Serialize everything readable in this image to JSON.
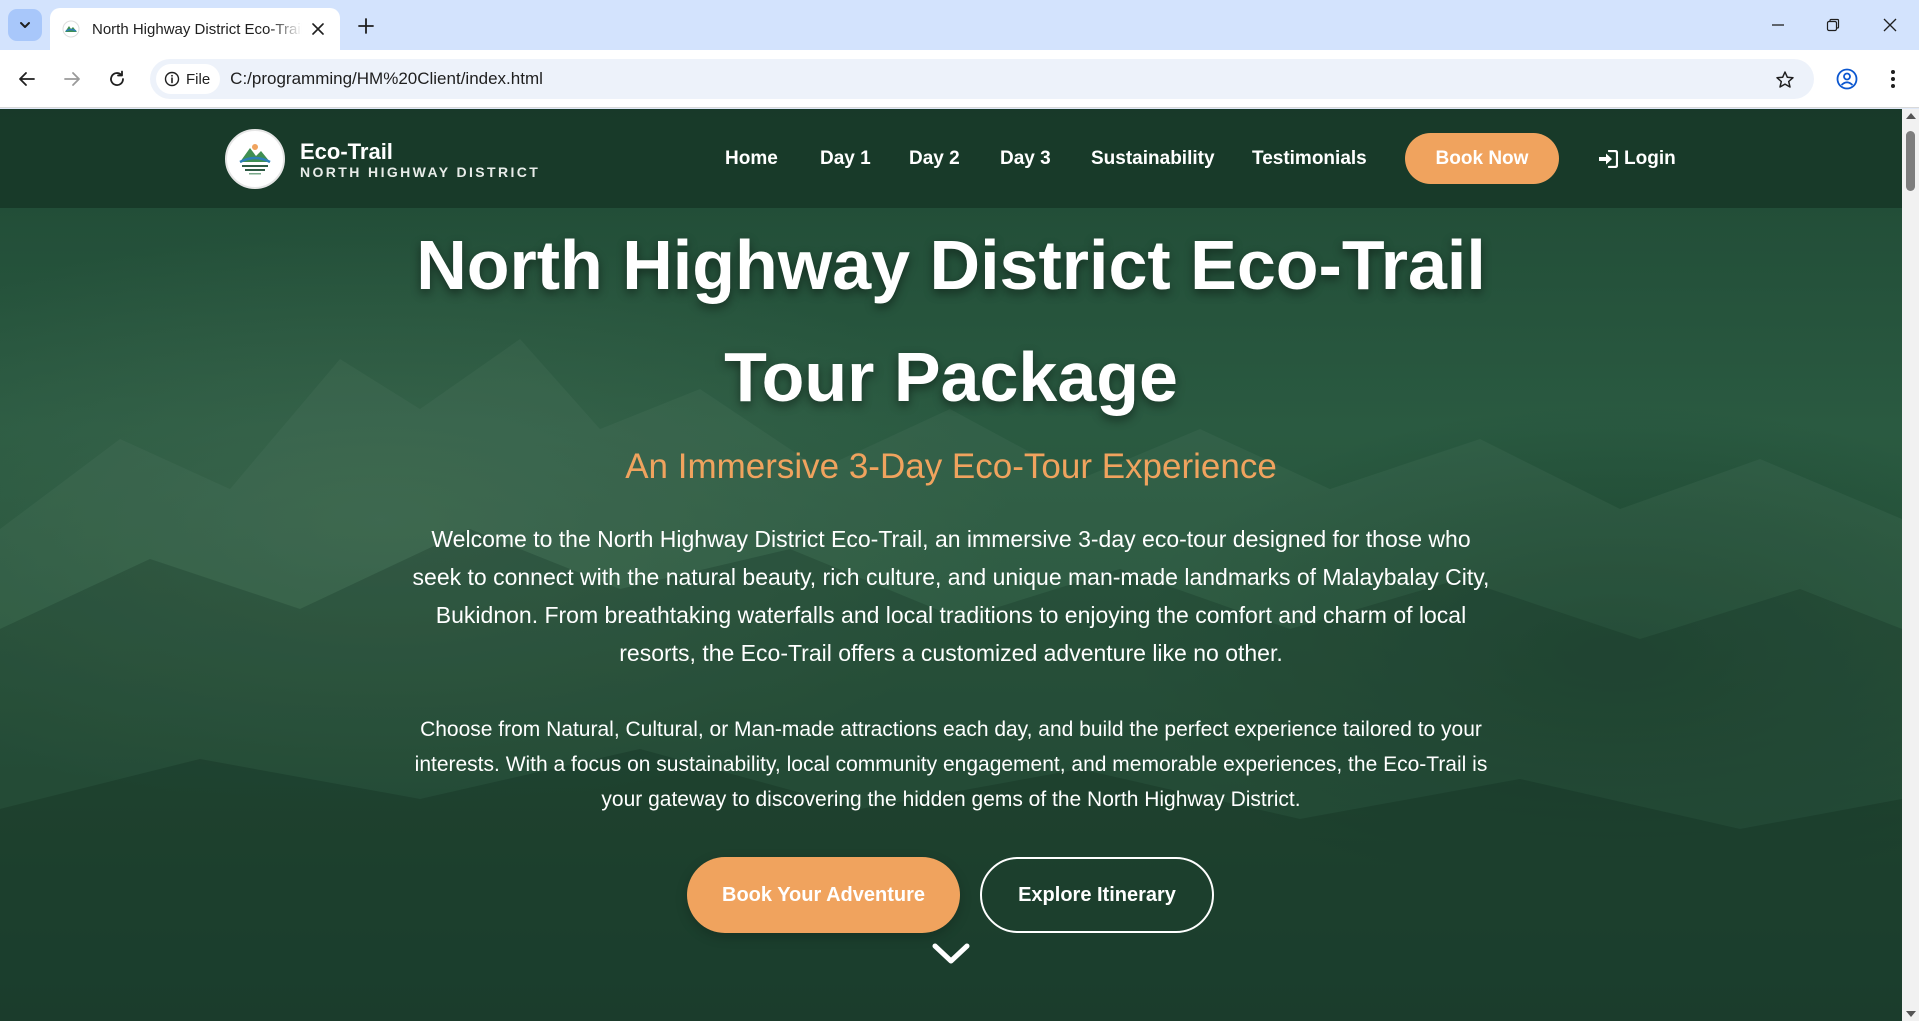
{
  "browser": {
    "tab_title": "North Highway District Eco-Trail",
    "site_chip_label": "File",
    "url": "C:/programming/HM%20Client/index.html"
  },
  "header": {
    "brand_title": "Eco-Trail",
    "brand_subtitle": "NORTH HIGHWAY DISTRICT",
    "nav": [
      {
        "label": "Home"
      },
      {
        "label": "Day 1"
      },
      {
        "label": "Day 2"
      },
      {
        "label": "Day 3"
      },
      {
        "label": "Sustainability"
      },
      {
        "label": "Testimonials"
      }
    ],
    "book_now_label": "Book Now",
    "login_label": "Login"
  },
  "hero": {
    "title_line1": "North Highway District Eco-Trail",
    "title_line2": "Tour Package",
    "subtitle": "An Immersive 3-Day Eco-Tour Experience",
    "paragraph1": "Welcome to the North Highway District Eco-Trail, an immersive 3-day eco-tour designed for those who seek to connect with the natural beauty, rich culture, and unique man-made landmarks of Malaybalay City, Bukidnon. From breathtaking waterfalls and local traditions to enjoying the comfort and charm of local resorts, the Eco-Trail offers a customized adventure like no other.",
    "paragraph2": "Choose from Natural, Cultural, or Man-made attractions each day, and build the perfect experience tailored to your interests. With a focus on sustainability, local community engagement, and memorable experiences, the Eco-Trail is your gateway to discovering the hidden gems of the North Highway District.",
    "cta_primary": "Book Your Adventure",
    "cta_secondary": "Explore Itinerary"
  },
  "colors": {
    "accent": "#f0a35e",
    "header_bg": "#183828",
    "hero_bg": "#265540"
  }
}
